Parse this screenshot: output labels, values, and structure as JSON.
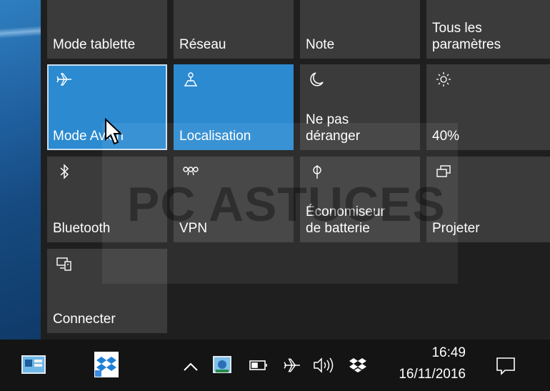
{
  "tiles": {
    "mode_tablette": "Mode tablette",
    "reseau": "Réseau",
    "note": "Note",
    "parametres": "Tous les\nparamètres",
    "mode_avion": "Mode Avion",
    "localisation": "Localisation",
    "ne_pas_deranger": "Ne pas\ndéranger",
    "luminosite": "40%",
    "bluetooth": "Bluetooth",
    "vpn": "VPN",
    "economiseur": "Économiseur\nde batterie",
    "projeter": "Projeter",
    "connecter": "Connecter"
  },
  "tile_states": {
    "mode_avion": "on",
    "localisation": "on"
  },
  "icons": {
    "mode_avion": "airplane-icon",
    "localisation": "location-icon",
    "ne_pas_deranger": "moon-icon",
    "luminosite": "brightness-icon",
    "bluetooth": "bluetooth-icon",
    "vpn": "vpn-icon",
    "economiseur": "battery-saver-icon",
    "projeter": "project-icon",
    "connecter": "connect-icon"
  },
  "watermark": "PC ASTUCES",
  "taskbar": {
    "time": "16:49",
    "date": "16/11/2016"
  },
  "colors": {
    "tile_on": "#2b8ad0",
    "tile_off": "#3b3b3b",
    "taskbar": "#141414"
  }
}
